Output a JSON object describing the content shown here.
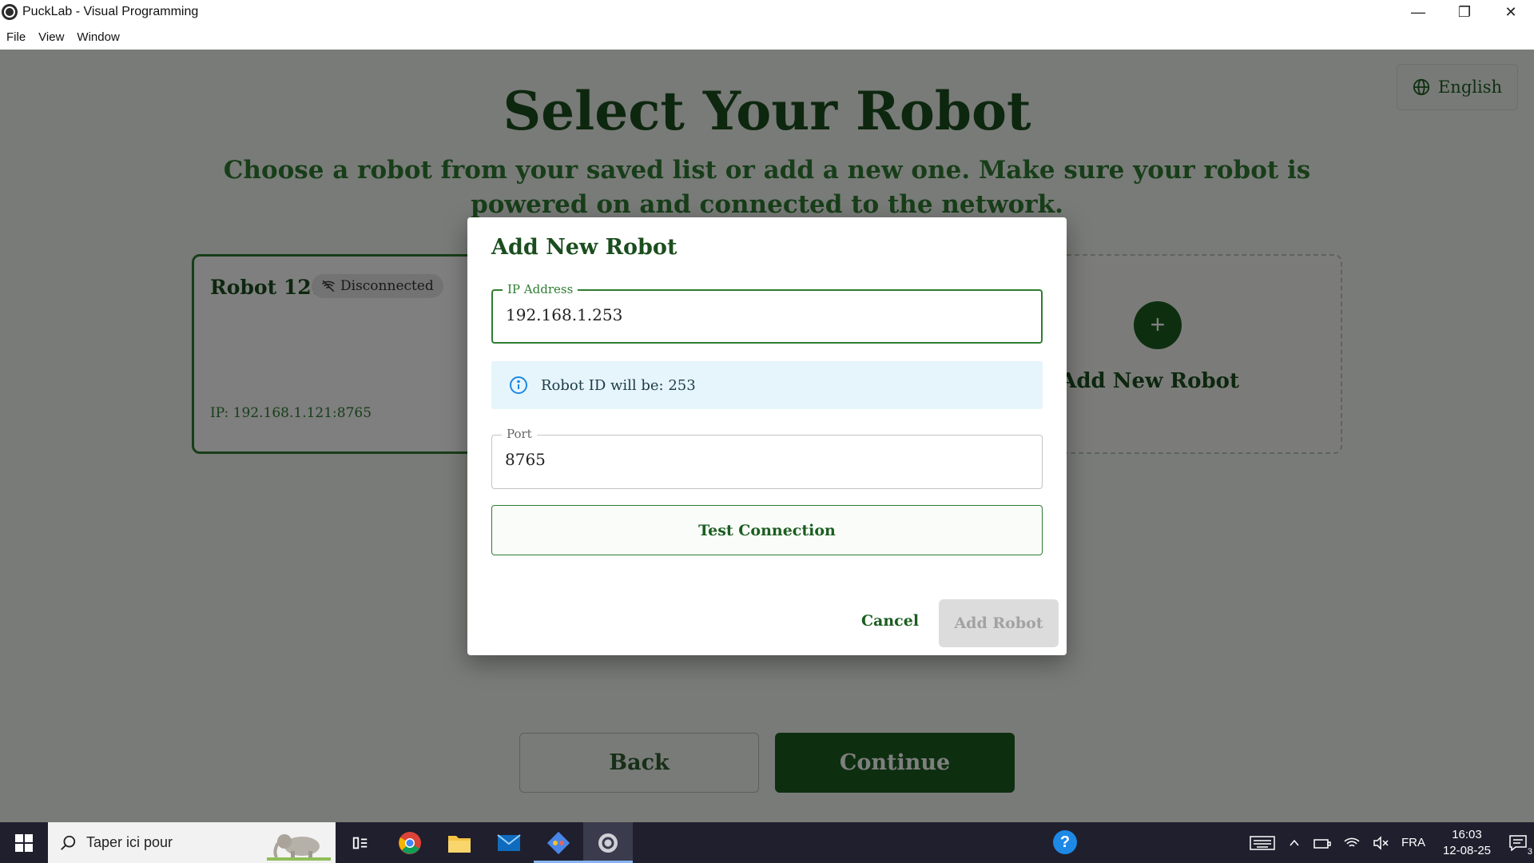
{
  "window": {
    "title": "PuckLab - Visual Programming",
    "controls": {
      "minimize": "—",
      "restore": "❐",
      "close": "✕"
    }
  },
  "menu": [
    "File",
    "View",
    "Window"
  ],
  "language": {
    "label": "English",
    "icon": "globe-icon"
  },
  "page": {
    "title": "Select Your Robot",
    "subtitle": "Choose a robot from your saved list or add a new one. Make sure your robot is powered on and connected to the network."
  },
  "robot_card": {
    "name": "Robot 121",
    "status": "Disconnected",
    "status_icon": "wifi-off-icon",
    "ip": "IP: 192.168.1.121:8765"
  },
  "add_card": {
    "label": "Add New Robot",
    "icon": "plus-icon"
  },
  "nav": {
    "back": "Back",
    "continue": "Continue"
  },
  "dialog": {
    "title": "Add New Robot",
    "ip_label": "IP Address",
    "ip_value": "192.168.1.253",
    "info_text": "Robot ID will be: 253",
    "info_icon": "info-icon",
    "port_label": "Port",
    "port_value": "8765",
    "test_label": "Test Connection",
    "cancel_label": "Cancel",
    "add_label": "Add Robot"
  },
  "taskbar": {
    "search_placeholder": "Taper ici pour",
    "apps": [
      "task-view-icon",
      "chrome-icon",
      "file-explorer-icon",
      "mail-icon",
      "git-icon",
      "pucklab-icon"
    ],
    "language": "FRA",
    "time": "16:03",
    "date": "12-08-25",
    "notifications": "3"
  },
  "colors": {
    "primary": "#1b5e20",
    "accent": "#2e7d32",
    "info_bg": "#e5f5fb",
    "taskbar": "#1f1f2e"
  }
}
